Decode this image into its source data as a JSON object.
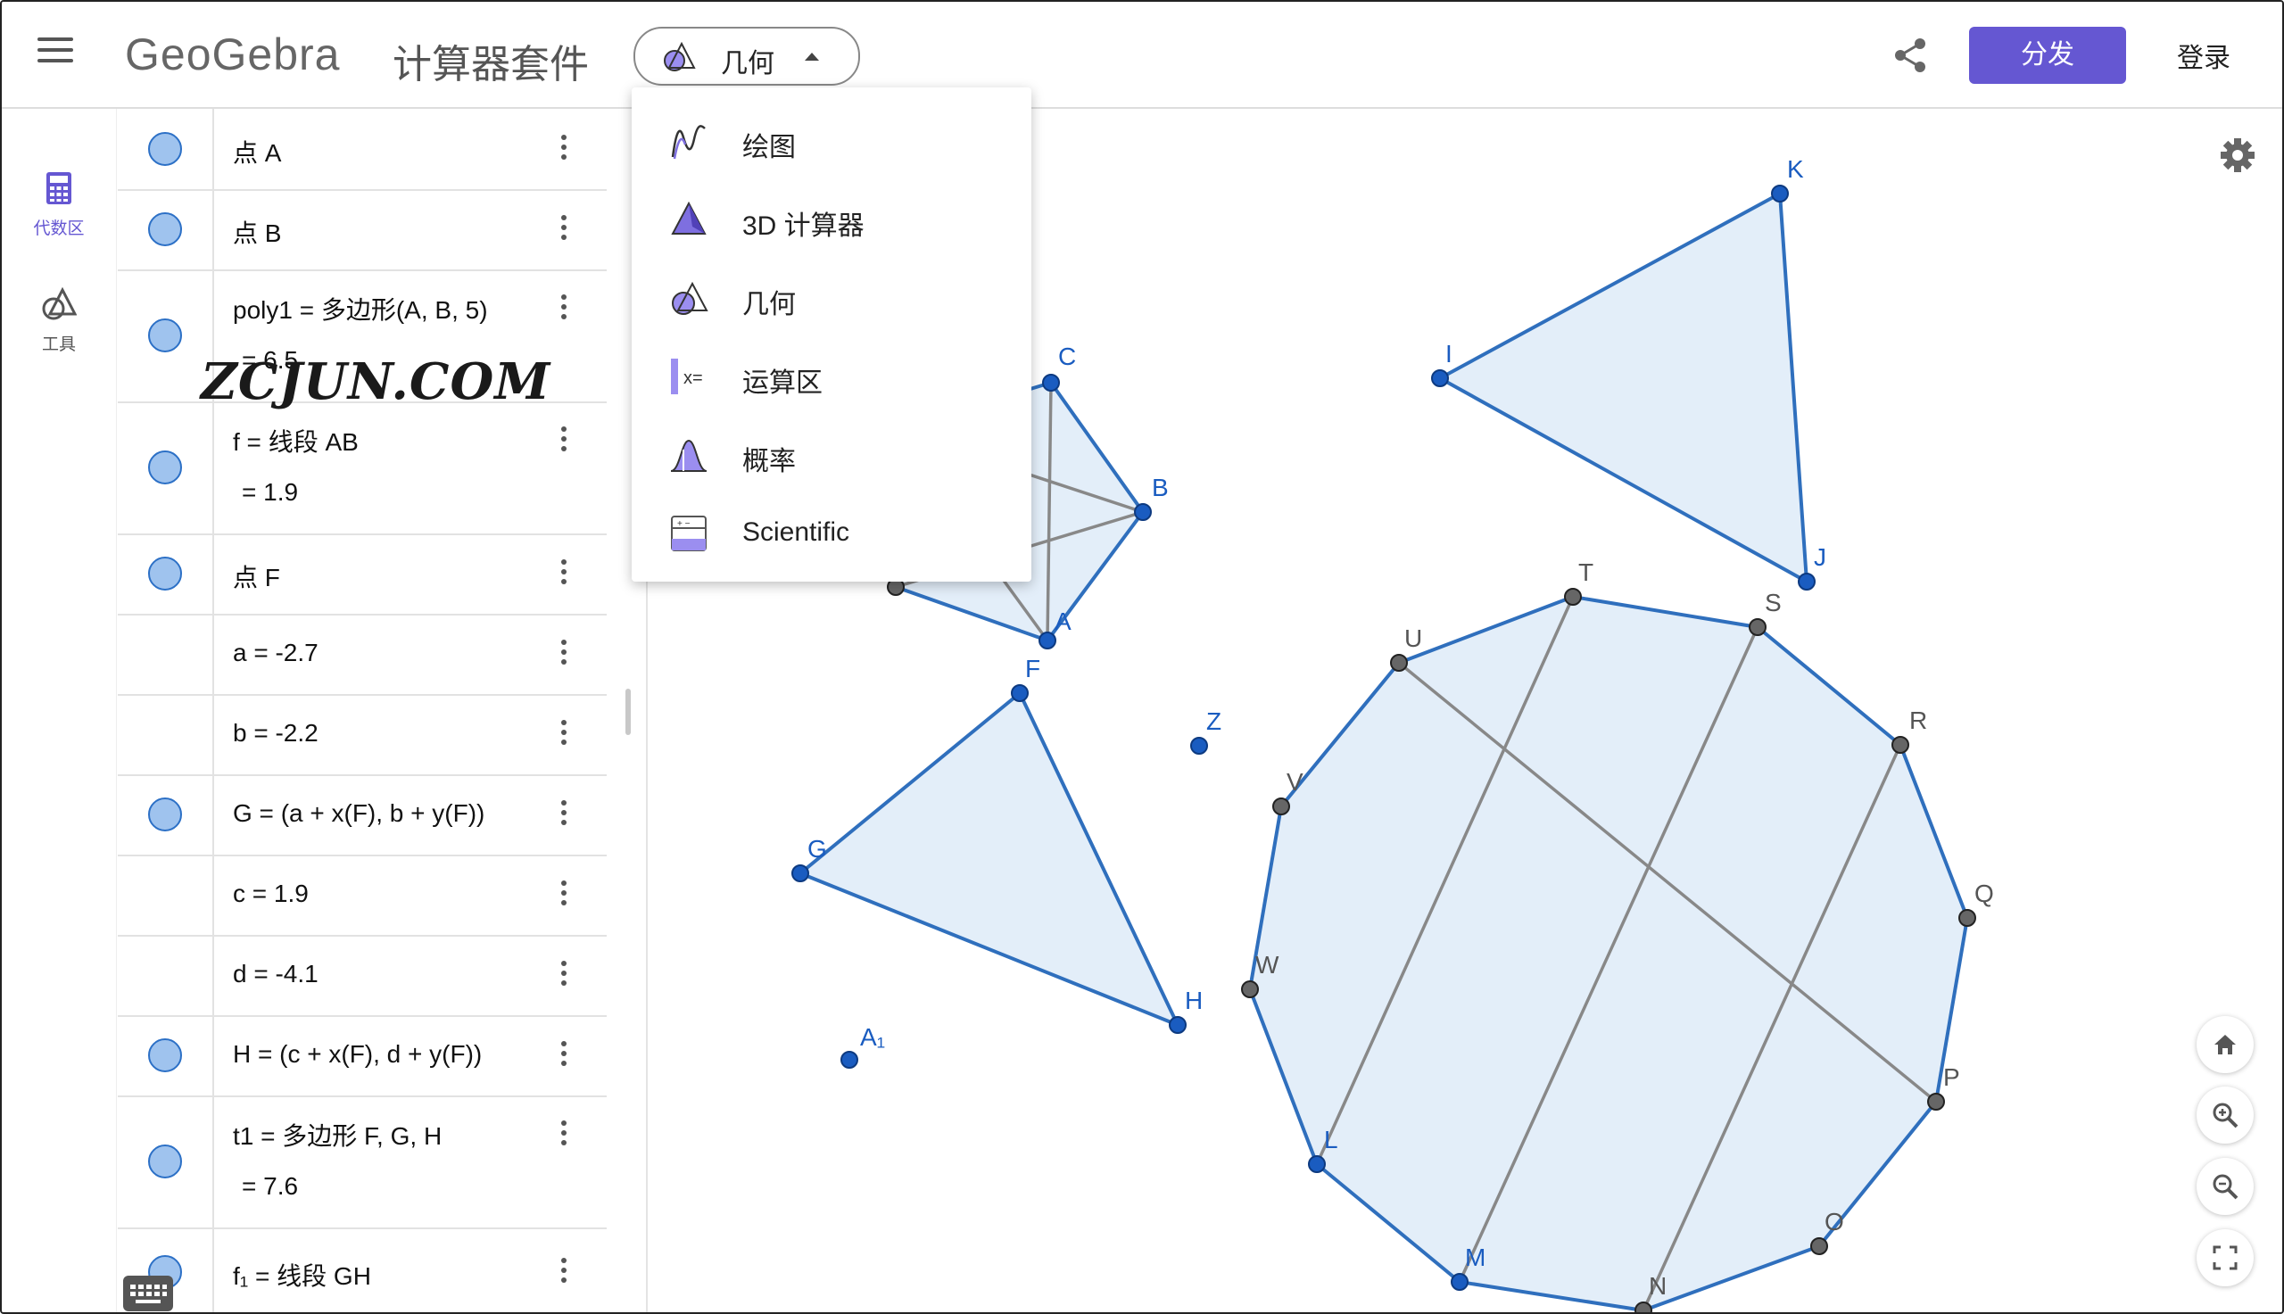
{
  "header": {
    "logo": "GeoGebra",
    "suite_title": "计算器套件",
    "app_picker_label": "几何",
    "distribute_label": "分发",
    "login_label": "登录"
  },
  "rail": {
    "algebra_label": "代数区",
    "tools_label": "工具"
  },
  "app_menu": {
    "items": [
      {
        "label": "绘图",
        "icon": "graphing-icon"
      },
      {
        "label": "3D 计算器",
        "icon": "3d-calculator-icon"
      },
      {
        "label": "几何",
        "icon": "geometry-icon"
      },
      {
        "label": "运算区",
        "icon": "cas-icon"
      },
      {
        "label": "概率",
        "icon": "probability-icon"
      },
      {
        "label": "Scientific",
        "icon": "scientific-calculator-icon"
      }
    ]
  },
  "algebra": {
    "rows": [
      {
        "expr": "点 A",
        "visible": true
      },
      {
        "expr": "点 B",
        "visible": true
      },
      {
        "expr": "poly1 = 多边形(A, B, 5)",
        "value": "=  6.5",
        "visible": true
      },
      {
        "expr": "f = 线段 AB",
        "value": "=  1.9",
        "visible": true
      },
      {
        "expr": "点 F",
        "visible": true
      },
      {
        "expr": "a = -2.7",
        "visible": false
      },
      {
        "expr": "b = -2.2",
        "visible": false
      },
      {
        "expr": "G = (a + x(F), b + y(F))",
        "visible": true
      },
      {
        "expr": "c = 1.9",
        "visible": false
      },
      {
        "expr": "d = -4.1",
        "visible": false
      },
      {
        "expr": "H = (c + x(F), d + y(F))",
        "visible": true
      },
      {
        "expr": "t1 = 多边形 F, G, H",
        "value": "=  7.6",
        "visible": true
      },
      {
        "expr": "f₁ = 线段 GH",
        "visible": true
      }
    ]
  },
  "watermark": "ZCJUN.COM",
  "graphics": {
    "point_labels": [
      "A",
      "B",
      "C",
      "F",
      "G",
      "H",
      "I",
      "J",
      "K",
      "Z",
      "A₁",
      "T",
      "S",
      "U",
      "R",
      "V",
      "Q",
      "W",
      "P",
      "L",
      "O",
      "M",
      "N"
    ],
    "fill_color": "#e3eef9",
    "edge_color": "#2f6fbd",
    "free_point_color": "#1a5cc0",
    "dependent_point_color": "#666666",
    "diagonal_color": "#888888"
  },
  "colors": {
    "accent": "#6557d2",
    "marble_fill": "#9fc3ee",
    "marble_border": "#2c70c6"
  }
}
